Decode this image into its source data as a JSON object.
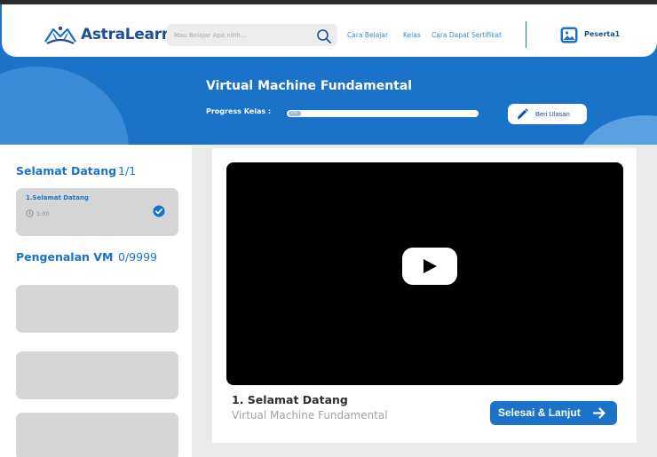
{
  "brand": {
    "name": "AstraLearn",
    "color": "#1d4e9a",
    "accent": "#1a73c9"
  },
  "search": {
    "placeholder": "Mau Belajar Apa nihh..."
  },
  "nav": {
    "links": [
      "Cara Belajar",
      "Kelas",
      "Cara Dapat Sertifikat"
    ],
    "user_label": "Peserta1"
  },
  "course": {
    "title": "Virtual Machine Fundamental",
    "progress_label": "Progress Kelas :",
    "progress_percent": 0,
    "progress_text": "0%",
    "review_button": "Beri Ulasan"
  },
  "sidebar": {
    "sections": [
      {
        "title": "Selamat Datang",
        "count": "1/1",
        "lessons": [
          {
            "title": "1.Selamat Datang",
            "duration": "1:00",
            "completed": true
          }
        ]
      },
      {
        "title": "Pengenalan VM",
        "count": "0/9999"
      }
    ]
  },
  "player": {
    "lesson_title": "1. Selamat Datang",
    "course_name": "Virtual Machine Fundamental",
    "next_button": "Selesai & Lanjut"
  },
  "icons": {
    "search": "search-icon",
    "user": "image-avatar-icon",
    "review": "pencil-icon",
    "duration": "clock-icon",
    "done": "check-circle-icon",
    "play": "play-icon",
    "next": "arrow-right-icon"
  }
}
